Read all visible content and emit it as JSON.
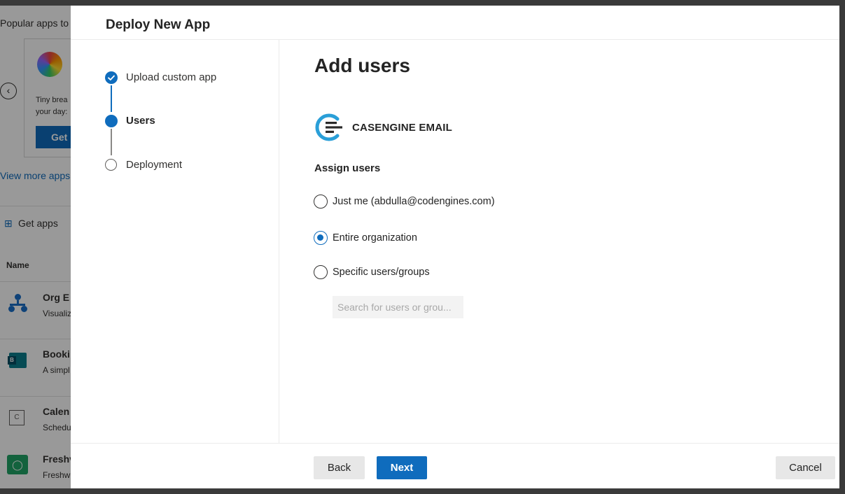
{
  "background": {
    "section_title": "Popular apps to",
    "promo_text_line1": "Tiny brea",
    "promo_text_line2": "your day:",
    "promo_button": "Get",
    "view_more_link": "View more apps",
    "get_apps": "Get apps",
    "column_name": "Name",
    "apps": [
      {
        "name": "Org E",
        "desc": "Visualiz"
      },
      {
        "name": "Booki",
        "desc": "A simpl"
      },
      {
        "name": "Calen",
        "desc": "Schedu"
      },
      {
        "name": "Freshv",
        "desc": "Freshw"
      }
    ],
    "calendar_icon_letter": "C"
  },
  "dialog": {
    "title": "Deploy New App",
    "steps": [
      {
        "label": "Upload custom app",
        "state": "completed"
      },
      {
        "label": "Users",
        "state": "current"
      },
      {
        "label": "Deployment",
        "state": "pending"
      }
    ],
    "content": {
      "title": "Add users",
      "app_name": "CASENGINE EMAIL",
      "assign_heading": "Assign users",
      "options": [
        {
          "label": "Just me (abdulla@codengines.com)",
          "checked": false
        },
        {
          "label": "Entire organization",
          "checked": true
        },
        {
          "label": "Specific users/groups",
          "checked": false
        }
      ],
      "search_placeholder": "Search for users or grou...",
      "search_value": ""
    },
    "footer": {
      "back_label": "Back",
      "next_label": "Next",
      "cancel_label": "Cancel"
    }
  },
  "colors": {
    "accent": "#0f6cbd",
    "logo_blue": "#2a9fd8",
    "overlay": "rgba(0,0,0,0.40)"
  }
}
